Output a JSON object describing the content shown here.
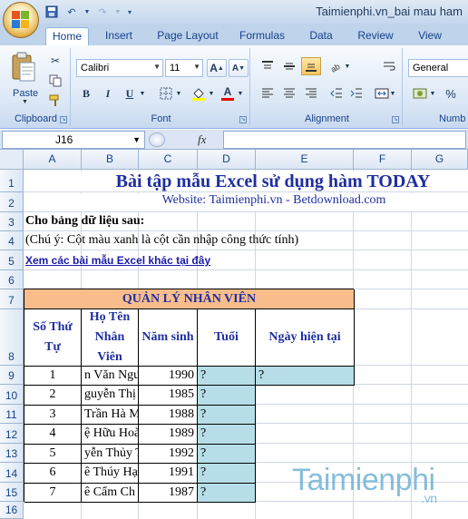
{
  "window": {
    "title": "Taimienphi.vn_bai mau ham"
  },
  "ribbon": {
    "tabs": [
      "Home",
      "Insert",
      "Page Layout",
      "Formulas",
      "Data",
      "Review",
      "View"
    ],
    "active_tab": "Home",
    "clipboard": {
      "paste_label": "Paste",
      "group_label": "Clipboard"
    },
    "font": {
      "family": "Calibri",
      "size": "11",
      "group_label": "Font",
      "bold": "B",
      "italic": "I",
      "underline": "U"
    },
    "alignment": {
      "group_label": "Alignment"
    },
    "number": {
      "format": "General",
      "group_label": "Numb"
    }
  },
  "formula_bar": {
    "name_box": "J16",
    "fx_label": "fx",
    "formula": ""
  },
  "grid": {
    "columns": [
      "A",
      "B",
      "C",
      "D",
      "E",
      "F",
      "G"
    ],
    "selected_column": "J",
    "rows": [
      "1",
      "2",
      "3",
      "4",
      "5",
      "6",
      "7",
      "8",
      "9",
      "10",
      "11",
      "12",
      "13",
      "14",
      "15",
      "16"
    ]
  },
  "sheet": {
    "title": "Bài tập mẫu Excel sử dụng hàm TODAY",
    "website": "Website: Taimienphi.vn - Betdownload.com",
    "intro": "Cho bảng dữ liệu sau:",
    "note": "(Chú ý: Cột màu xanh là cột cần nhập công thức tính)",
    "link": "Xem các bài mẫu Excel khác tại đây",
    "table_title": "QUẢN LÝ NHÂN VIÊN",
    "headers": {
      "stt": "Số Thứ Tự",
      "name": "Họ Tên Nhân Viên",
      "birth": "Năm sinh",
      "age": "Tuổi",
      "today": "Ngày hiện tại"
    },
    "rows": [
      {
        "stt": "1",
        "name": "n Văn Ngu",
        "birth": "1990",
        "age": "?",
        "today": "?"
      },
      {
        "stt": "2",
        "name": "guyễn Thị I",
        "birth": "1985",
        "age": "?",
        "today": ""
      },
      {
        "stt": "3",
        "name": "Trần Hà M",
        "birth": "1988",
        "age": "?",
        "today": ""
      },
      {
        "stt": "4",
        "name": "ệ Hữu Hoà",
        "birth": "1989",
        "age": "?",
        "today": ""
      },
      {
        "stt": "5",
        "name": "yễn Thủy T",
        "birth": "1992",
        "age": "?",
        "today": ""
      },
      {
        "stt": "6",
        "name": "ê Thúy Hạ",
        "birth": "1991",
        "age": "?",
        "today": ""
      },
      {
        "stt": "7",
        "name": "ê Cẩm Ch",
        "birth": "1987",
        "age": "?",
        "today": ""
      }
    ]
  },
  "watermark": {
    "text": "Taimienphi",
    "suffix": ".vn"
  }
}
